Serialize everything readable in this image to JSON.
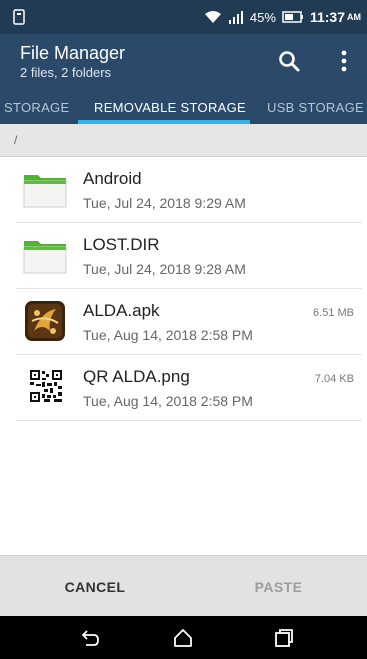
{
  "status_bar": {
    "battery": "45%",
    "time": "11:37",
    "ampm": "AM"
  },
  "app_bar": {
    "title": "File Manager",
    "subtitle": "2 files, 2 folders",
    "icons": [
      "search-icon",
      "more-vert-icon"
    ]
  },
  "tabs": [
    {
      "label": "STORAGE"
    },
    {
      "label": "REMOVABLE STORAGE",
      "active": true
    },
    {
      "label": "USB STORAGE"
    }
  ],
  "path": "/",
  "files": [
    {
      "name": "Android",
      "date": "Tue, Jul 24, 2018 9:29 AM",
      "size": "",
      "icon": "folder-icon"
    },
    {
      "name": "LOST.DIR",
      "date": "Tue, Jul 24, 2018 9:28 AM",
      "size": "",
      "icon": "folder-icon"
    },
    {
      "name": "ALDA.apk",
      "date": "Tue, Aug 14, 2018 2:58 PM",
      "size": "6.51 MB",
      "icon": "apk-icon"
    },
    {
      "name": "QR ALDA.png",
      "date": "Tue, Aug 14, 2018 2:58 PM",
      "size": "7.04 KB",
      "icon": "qr-image-icon"
    }
  ],
  "actions": {
    "cancel": "CANCEL",
    "paste": "PASTE"
  },
  "colors": {
    "status_bar": "#213b55",
    "app_bar": "#2b4a69",
    "tab_indicator": "#35b3e6",
    "folder": "#5bbf3a"
  }
}
